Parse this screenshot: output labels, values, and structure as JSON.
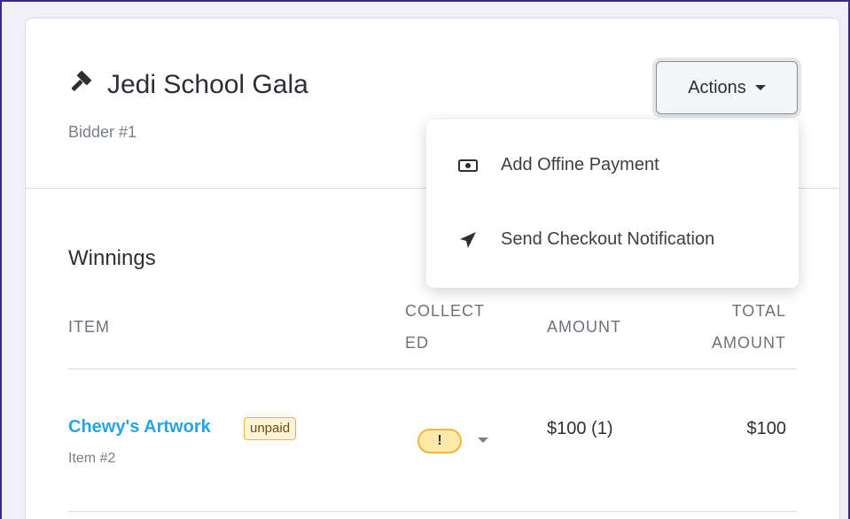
{
  "header": {
    "title": "Jedi School Gala",
    "subtitle": "Bidder #1",
    "actions_label": "Actions"
  },
  "dropdown": {
    "items": [
      {
        "label": "Add Offine Payment",
        "icon": "money-bill-icon"
      },
      {
        "label": "Send Checkout Notification",
        "icon": "paper-plane-icon"
      }
    ]
  },
  "winnings": {
    "title": "Winnings",
    "columns": {
      "item": "ITEM",
      "collected_line1": "COLLECT",
      "collected_line2": "ED",
      "amount": "AMOUNT",
      "total_line1": "TOTAL",
      "total_line2": "AMOUNT"
    },
    "rows": [
      {
        "name": "Chewy's Artwork",
        "badge": "unpaid",
        "sub": "Item #2",
        "collected_status": "!",
        "amount": "$100 (1)",
        "total": "$100"
      }
    ]
  },
  "colors": {
    "link": "#2aa3e6",
    "warning": "#f0b43a",
    "frame": "#3b2a86"
  }
}
